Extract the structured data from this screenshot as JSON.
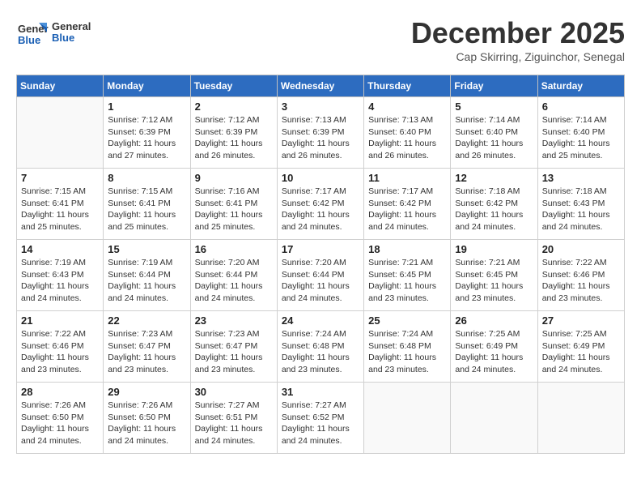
{
  "logo": {
    "general": "General",
    "blue": "Blue"
  },
  "title": "December 2025",
  "subtitle": "Cap Skirring, Ziguinchor, Senegal",
  "days_of_week": [
    "Sunday",
    "Monday",
    "Tuesday",
    "Wednesday",
    "Thursday",
    "Friday",
    "Saturday"
  ],
  "weeks": [
    [
      {
        "day": "",
        "info": ""
      },
      {
        "day": "1",
        "info": "Sunrise: 7:12 AM\nSunset: 6:39 PM\nDaylight: 11 hours and 27 minutes."
      },
      {
        "day": "2",
        "info": "Sunrise: 7:12 AM\nSunset: 6:39 PM\nDaylight: 11 hours and 26 minutes."
      },
      {
        "day": "3",
        "info": "Sunrise: 7:13 AM\nSunset: 6:39 PM\nDaylight: 11 hours and 26 minutes."
      },
      {
        "day": "4",
        "info": "Sunrise: 7:13 AM\nSunset: 6:40 PM\nDaylight: 11 hours and 26 minutes."
      },
      {
        "day": "5",
        "info": "Sunrise: 7:14 AM\nSunset: 6:40 PM\nDaylight: 11 hours and 26 minutes."
      },
      {
        "day": "6",
        "info": "Sunrise: 7:14 AM\nSunset: 6:40 PM\nDaylight: 11 hours and 25 minutes."
      }
    ],
    [
      {
        "day": "7",
        "info": "Sunrise: 7:15 AM\nSunset: 6:41 PM\nDaylight: 11 hours and 25 minutes."
      },
      {
        "day": "8",
        "info": "Sunrise: 7:15 AM\nSunset: 6:41 PM\nDaylight: 11 hours and 25 minutes."
      },
      {
        "day": "9",
        "info": "Sunrise: 7:16 AM\nSunset: 6:41 PM\nDaylight: 11 hours and 25 minutes."
      },
      {
        "day": "10",
        "info": "Sunrise: 7:17 AM\nSunset: 6:42 PM\nDaylight: 11 hours and 24 minutes."
      },
      {
        "day": "11",
        "info": "Sunrise: 7:17 AM\nSunset: 6:42 PM\nDaylight: 11 hours and 24 minutes."
      },
      {
        "day": "12",
        "info": "Sunrise: 7:18 AM\nSunset: 6:42 PM\nDaylight: 11 hours and 24 minutes."
      },
      {
        "day": "13",
        "info": "Sunrise: 7:18 AM\nSunset: 6:43 PM\nDaylight: 11 hours and 24 minutes."
      }
    ],
    [
      {
        "day": "14",
        "info": "Sunrise: 7:19 AM\nSunset: 6:43 PM\nDaylight: 11 hours and 24 minutes."
      },
      {
        "day": "15",
        "info": "Sunrise: 7:19 AM\nSunset: 6:44 PM\nDaylight: 11 hours and 24 minutes."
      },
      {
        "day": "16",
        "info": "Sunrise: 7:20 AM\nSunset: 6:44 PM\nDaylight: 11 hours and 24 minutes."
      },
      {
        "day": "17",
        "info": "Sunrise: 7:20 AM\nSunset: 6:44 PM\nDaylight: 11 hours and 24 minutes."
      },
      {
        "day": "18",
        "info": "Sunrise: 7:21 AM\nSunset: 6:45 PM\nDaylight: 11 hours and 23 minutes."
      },
      {
        "day": "19",
        "info": "Sunrise: 7:21 AM\nSunset: 6:45 PM\nDaylight: 11 hours and 23 minutes."
      },
      {
        "day": "20",
        "info": "Sunrise: 7:22 AM\nSunset: 6:46 PM\nDaylight: 11 hours and 23 minutes."
      }
    ],
    [
      {
        "day": "21",
        "info": "Sunrise: 7:22 AM\nSunset: 6:46 PM\nDaylight: 11 hours and 23 minutes."
      },
      {
        "day": "22",
        "info": "Sunrise: 7:23 AM\nSunset: 6:47 PM\nDaylight: 11 hours and 23 minutes."
      },
      {
        "day": "23",
        "info": "Sunrise: 7:23 AM\nSunset: 6:47 PM\nDaylight: 11 hours and 23 minutes."
      },
      {
        "day": "24",
        "info": "Sunrise: 7:24 AM\nSunset: 6:48 PM\nDaylight: 11 hours and 23 minutes."
      },
      {
        "day": "25",
        "info": "Sunrise: 7:24 AM\nSunset: 6:48 PM\nDaylight: 11 hours and 23 minutes."
      },
      {
        "day": "26",
        "info": "Sunrise: 7:25 AM\nSunset: 6:49 PM\nDaylight: 11 hours and 24 minutes."
      },
      {
        "day": "27",
        "info": "Sunrise: 7:25 AM\nSunset: 6:49 PM\nDaylight: 11 hours and 24 minutes."
      }
    ],
    [
      {
        "day": "28",
        "info": "Sunrise: 7:26 AM\nSunset: 6:50 PM\nDaylight: 11 hours and 24 minutes."
      },
      {
        "day": "29",
        "info": "Sunrise: 7:26 AM\nSunset: 6:50 PM\nDaylight: 11 hours and 24 minutes."
      },
      {
        "day": "30",
        "info": "Sunrise: 7:27 AM\nSunset: 6:51 PM\nDaylight: 11 hours and 24 minutes."
      },
      {
        "day": "31",
        "info": "Sunrise: 7:27 AM\nSunset: 6:52 PM\nDaylight: 11 hours and 24 minutes."
      },
      {
        "day": "",
        "info": ""
      },
      {
        "day": "",
        "info": ""
      },
      {
        "day": "",
        "info": ""
      }
    ]
  ]
}
